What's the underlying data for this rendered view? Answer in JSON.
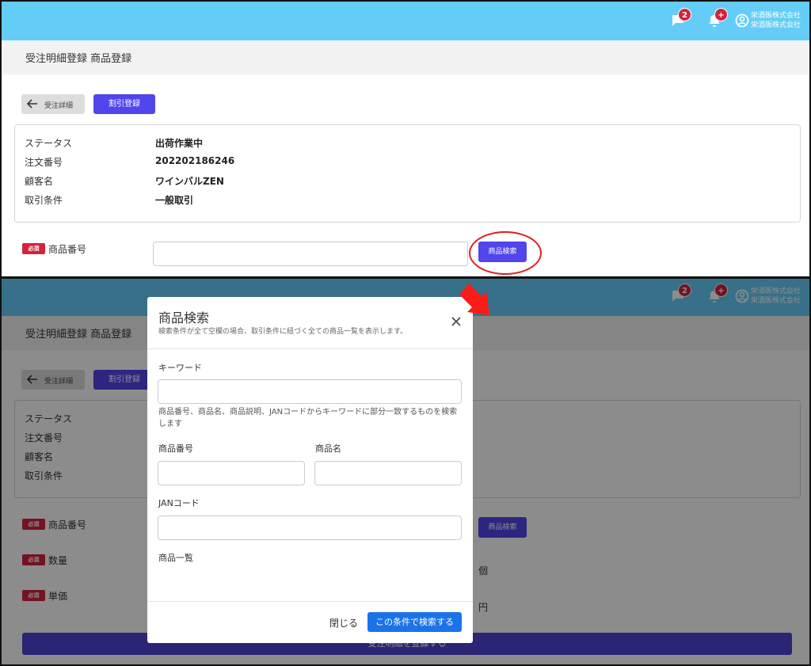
{
  "header": {
    "messages_badge": "2",
    "notifications_badge": "+",
    "company_line1": "栄酒販株式会社",
    "company_line2": "栄酒販株式会社",
    "bg_color": "#64cdf7"
  },
  "page": {
    "title": "受注明細登録 商品登録",
    "back_label": "受注詳細",
    "discount_label": "割引登録"
  },
  "order_info": {
    "rows": [
      {
        "label": "ステータス",
        "value": "出荷作業中"
      },
      {
        "label": "注文番号",
        "value": "202202186246"
      },
      {
        "label": "顧客名",
        "value": "ワインバルZEN"
      },
      {
        "label": "取引条件",
        "value": "一般取引"
      }
    ]
  },
  "form": {
    "required_badge": "必須",
    "product_no_label": "商品番号",
    "quantity_label": "数量",
    "unit_price_label": "単価",
    "quantity_unit": "個",
    "price_unit": "円",
    "search_button": "商品検索",
    "submit_button": "受注明細を登録する"
  },
  "modal": {
    "title": "商品検索",
    "subtitle": "検索条件が全て空欄の場合、取引条件に紐づく全ての商品一覧を表示します。",
    "keyword_label": "キーワード",
    "keyword_help": "商品番号、商品名、商品説明、JANコードからキーワードに部分一致するものを検索します",
    "product_no_label": "商品番号",
    "product_name_label": "商品名",
    "jan_label": "JANコード",
    "list_label": "商品一覧",
    "close_label": "閉じる",
    "search_button": "この条件で検索する",
    "accent_color": "#1a73e8"
  },
  "colors": {
    "primary_button": "#5046ec",
    "required_badge": "#d1243b",
    "annotation": "#e02020"
  }
}
